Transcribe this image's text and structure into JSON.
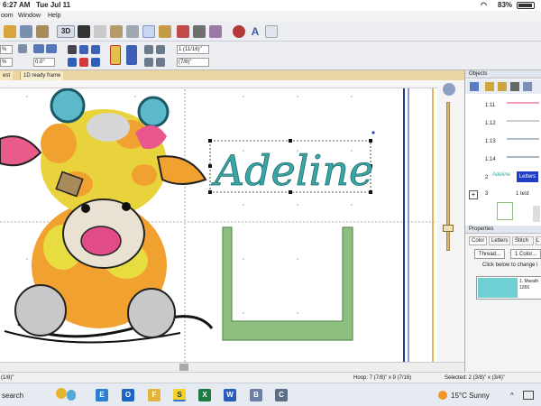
{
  "ios_status": {
    "time": "6:27 AM",
    "date": "Tue Jul 11",
    "battery": "83%"
  },
  "menu": [
    "oom",
    "Window",
    "Help"
  ],
  "toolbar": {
    "btn_3d": "3D",
    "field_1": "1 (11/16)\"",
    "field_2": "(7/8)\"",
    "rot_field": "0.0°",
    "pct_1": "%",
    "pct_2": "%"
  },
  "tabs": [
    "est",
    "1D ready frame"
  ],
  "canvas": {
    "name_text": "Adeline",
    "frame_color": "#8cbf7f",
    "text_color": "#3aa6a6"
  },
  "status": {
    "left": "(1/8)\"",
    "hoop": "Hoop: 7 (7/8)\" x 9 (7/16)",
    "selected": "Selected: 2 (3/8)\" x (3/4)\""
  },
  "objects_panel": {
    "title": "Objects",
    "rows": [
      {
        "label": "1:11"
      },
      {
        "label": "1:12"
      },
      {
        "label": "1:13"
      },
      {
        "label": "1:14"
      },
      {
        "label": "2",
        "thumb": "Adeline",
        "badge": "Letters"
      },
      {
        "label": "3",
        "text": "1 test"
      }
    ]
  },
  "properties_panel": {
    "title": "Properties",
    "tabs": [
      "Color",
      "Letters",
      "Stitch",
      "L"
    ],
    "buttons": [
      "Thread...",
      "1 Color..."
    ],
    "hint": "Click below to change i",
    "thread": {
      "name": "1. Marath",
      "code": "1266",
      "swatch": "#6fd0d4"
    }
  },
  "taskbar": {
    "search": "search",
    "weather": "15°C  Sunny",
    "apps": [
      "E",
      "O",
      "F",
      "S",
      "X",
      "W",
      "B",
      "C"
    ]
  }
}
